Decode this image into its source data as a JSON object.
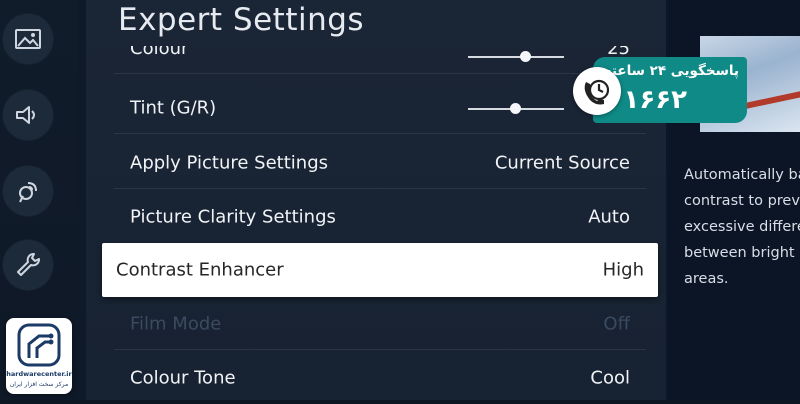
{
  "sidebar": {
    "items": [
      {
        "icon": "picture-icon"
      },
      {
        "icon": "sound-icon"
      },
      {
        "icon": "broadcasting-icon"
      },
      {
        "icon": "support-wrench-icon"
      }
    ]
  },
  "menu": {
    "title": "Expert Settings",
    "rows": [
      {
        "label": "Colour",
        "value": "25",
        "control": "slider",
        "level": 0.58
      },
      {
        "label": "Tint (G/R)",
        "value": "",
        "control": "slider",
        "level": 0.48
      },
      {
        "label": "Apply Picture Settings",
        "value": "Current Source"
      },
      {
        "label": "Picture Clarity Settings",
        "value": "Auto"
      },
      {
        "label": "Contrast Enhancer",
        "value": "High",
        "selected": true
      },
      {
        "label": "Film Mode",
        "value": "Off",
        "disabled": true
      },
      {
        "label": "Colour Tone",
        "value": "Cool"
      }
    ]
  },
  "description": {
    "text": "Automatically ba\ncontrast to preve\nexcessive differe\nbetween bright a\nareas."
  },
  "badge": {
    "title": "پاسخگویی ۲۴ ساعته",
    "number": "۱۶۶۲",
    "icon": "phone-clock-icon",
    "color": "#0f8a87"
  },
  "logo": {
    "text": "hardwarecenter.ir",
    "subtext": "مرکز سخت افزار ایران"
  },
  "colors": {
    "selected_row_bg": "#ffffff",
    "accent_badge": "#0f8a87"
  }
}
